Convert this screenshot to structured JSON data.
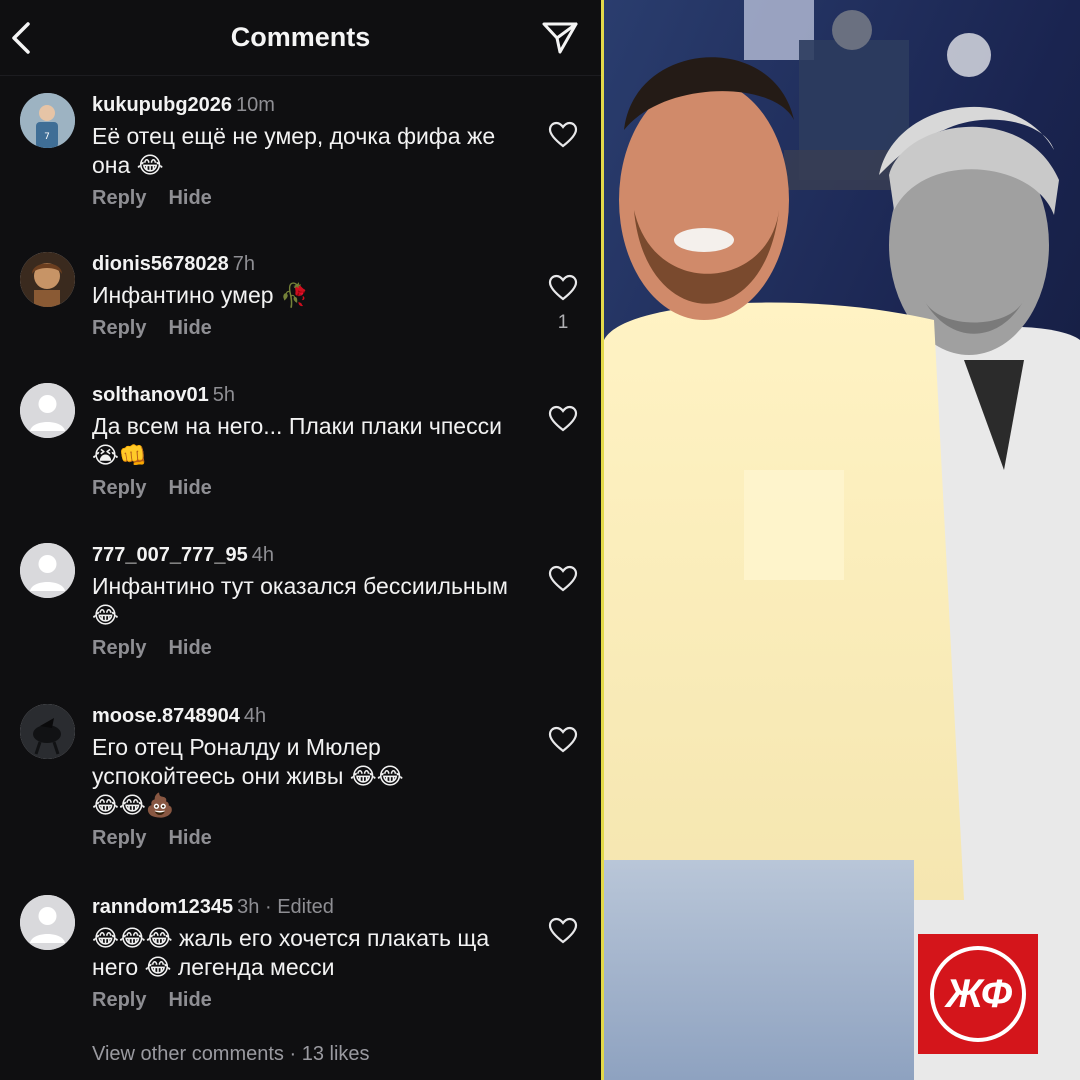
{
  "header": {
    "title": "Comments"
  },
  "comments": [
    {
      "username": "kukupubg2026",
      "time": "10m",
      "text": "Её отец ещё не умер, дочка фифа же она 😂",
      "reply_label": "Reply",
      "hide_label": "Hide",
      "likes": ""
    },
    {
      "username": "dionis5678028",
      "time": "7h",
      "text": "Инфантино умер 🥀",
      "reply_label": "Reply",
      "hide_label": "Hide",
      "likes": "1"
    },
    {
      "username": "solthanov01",
      "time": "5h",
      "text": "Да всем на него... Плаки плаки чпесси 😭👊",
      "reply_label": "Reply",
      "hide_label": "Hide",
      "likes": ""
    },
    {
      "username": "777_007_777_95",
      "time": "4h",
      "text": "Инфантино тут оказался бессиильным 😂",
      "reply_label": "Reply",
      "hide_label": "Hide",
      "likes": ""
    },
    {
      "username": "moose.8748904",
      "time": "4h",
      "text_line1": "Его отец Роналду и Мюлер",
      "text_line2": "успокойтеесь они живы 😂😂",
      "text_line3": "😂😂💩",
      "reply_label": "Reply",
      "hide_label": "Hide",
      "likes": ""
    },
    {
      "username": "ranndom12345",
      "time": "3h · Edited",
      "text": "😂😂😂 жаль его хочется плакать ща него 😂 легенда месси",
      "reply_label": "Reply",
      "hide_label": "Hide",
      "likes": ""
    }
  ],
  "footer": {
    "view_other": "View other comments",
    "likes_text": "· 13 likes"
  },
  "logo": {
    "text": "ЖФ"
  },
  "colors": {
    "panel_bg": "#0f0f11",
    "secondary_text": "#8e8e93",
    "divider": "#e3d94a",
    "logo_red": "#d4151b"
  },
  "icons": {
    "back": "chevron-left-icon",
    "share": "paper-plane-icon",
    "like": "heart-outline-icon",
    "default_avatar": "person-silhouette-icon"
  }
}
